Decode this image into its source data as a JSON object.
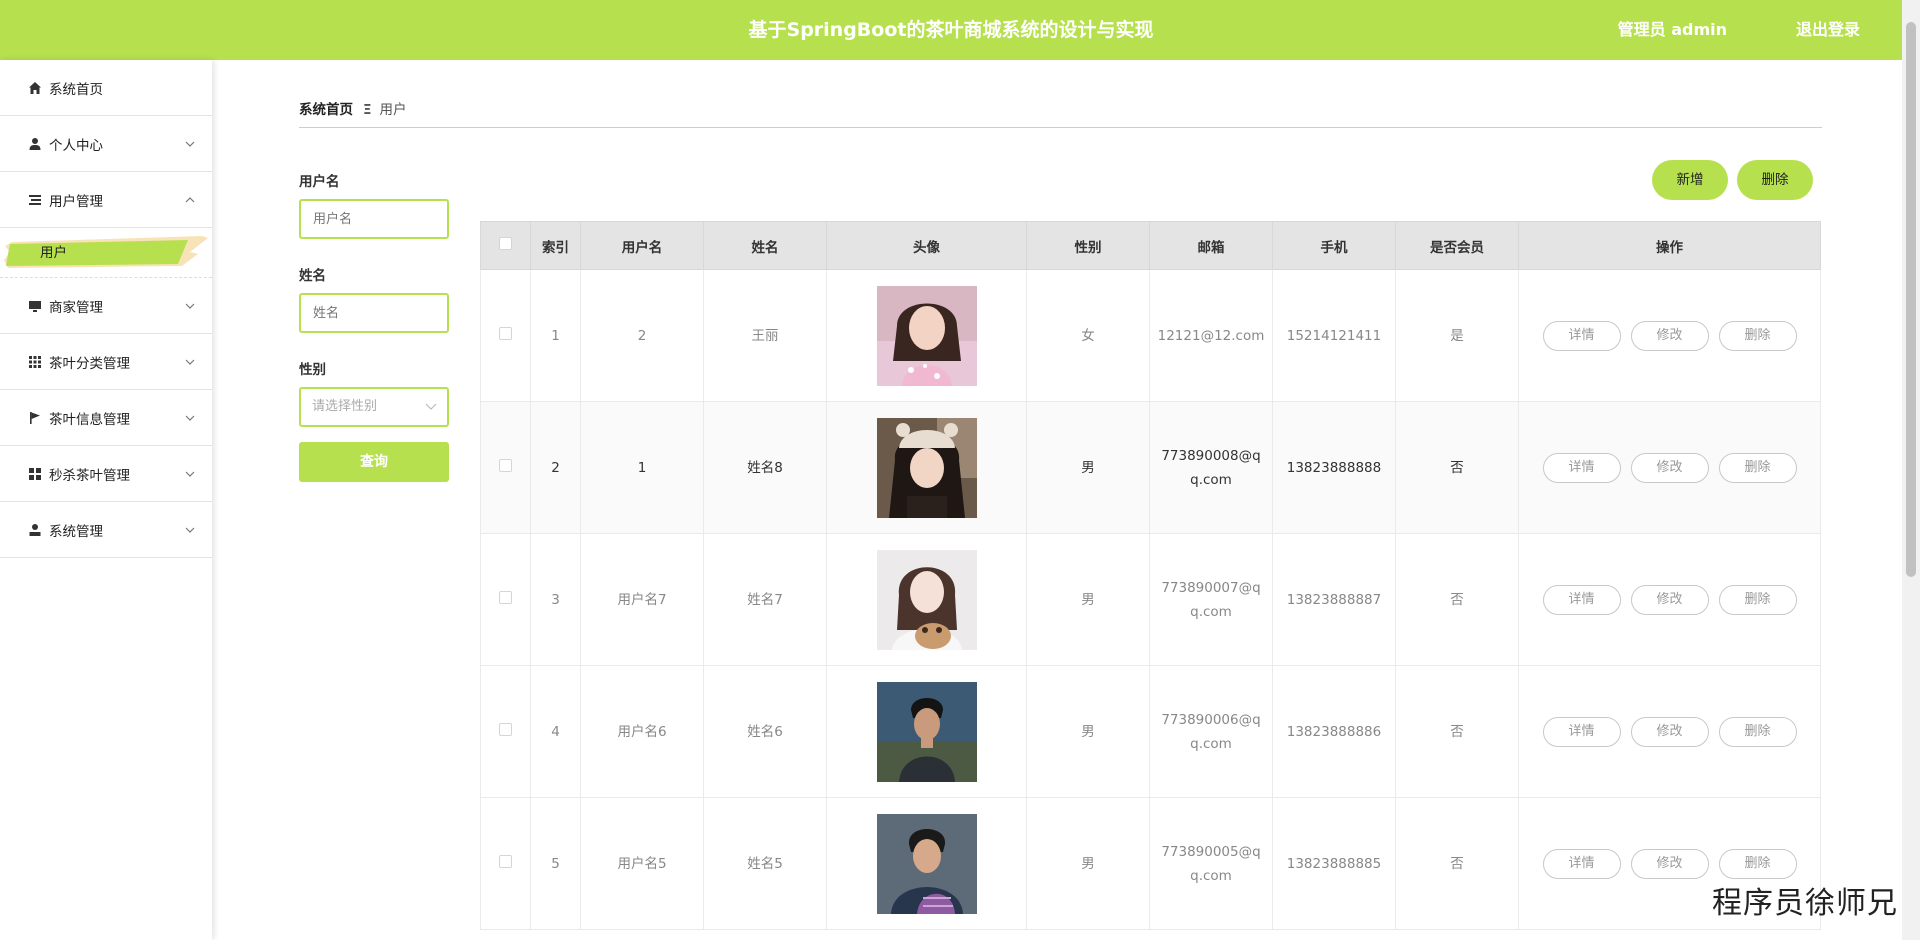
{
  "header": {
    "title": "基于SpringBoot的茶叶商城系统的设计与实现",
    "user": "管理员 admin",
    "logout": "退出登录"
  },
  "sidebar": {
    "items": [
      {
        "label": "系统首页",
        "icon": "home-icon"
      },
      {
        "label": "个人中心",
        "icon": "person-icon"
      },
      {
        "label": "用户管理",
        "icon": "list-icon",
        "expanded": true
      },
      {
        "label": "商家管理",
        "icon": "monitor-icon"
      },
      {
        "label": "茶叶分类管理",
        "icon": "grid-icon"
      },
      {
        "label": "茶叶信息管理",
        "icon": "flag-icon"
      },
      {
        "label": "秒杀茶叶管理",
        "icon": "grid-icon"
      },
      {
        "label": "系统管理",
        "icon": "user-icon"
      }
    ],
    "submenu": {
      "label": "用户"
    }
  },
  "breadcrumb": {
    "home": "系统首页",
    "current": "用户"
  },
  "filters": {
    "username_label": "用户名",
    "username_placeholder": "用户名",
    "name_label": "姓名",
    "name_placeholder": "姓名",
    "gender_label": "性别",
    "gender_placeholder": "请选择性别",
    "search_button": "查询"
  },
  "toolbar": {
    "add": "新增",
    "delete": "删除"
  },
  "table": {
    "headers": [
      "索引",
      "用户名",
      "姓名",
      "头像",
      "性别",
      "邮箱",
      "手机",
      "是否会员",
      "操作"
    ],
    "rows": [
      {
        "index": "1",
        "username": "2",
        "name": "王丽",
        "gender": "女",
        "email": "12121@12.com",
        "phone": "15214121411",
        "member": "是"
      },
      {
        "index": "2",
        "username": "1",
        "name": "姓名8",
        "gender": "男",
        "email": "773890008@qq.com",
        "phone": "13823888888",
        "member": "否"
      },
      {
        "index": "3",
        "username": "用户名7",
        "name": "姓名7",
        "gender": "男",
        "email": "773890007@qq.com",
        "phone": "13823888887",
        "member": "否"
      },
      {
        "index": "4",
        "username": "用户名6",
        "name": "姓名6",
        "gender": "男",
        "email": "773890006@qq.com",
        "phone": "13823888886",
        "member": "否"
      },
      {
        "index": "5",
        "username": "用户名5",
        "name": "姓名5",
        "gender": "男",
        "email": "773890005@qq.com",
        "phone": "13823888885",
        "member": "否"
      }
    ],
    "ops": {
      "detail": "详情",
      "edit": "修改",
      "delete": "删除"
    }
  },
  "watermark": "程序员徐师兄",
  "colors": {
    "accent": "#b7e04f"
  }
}
